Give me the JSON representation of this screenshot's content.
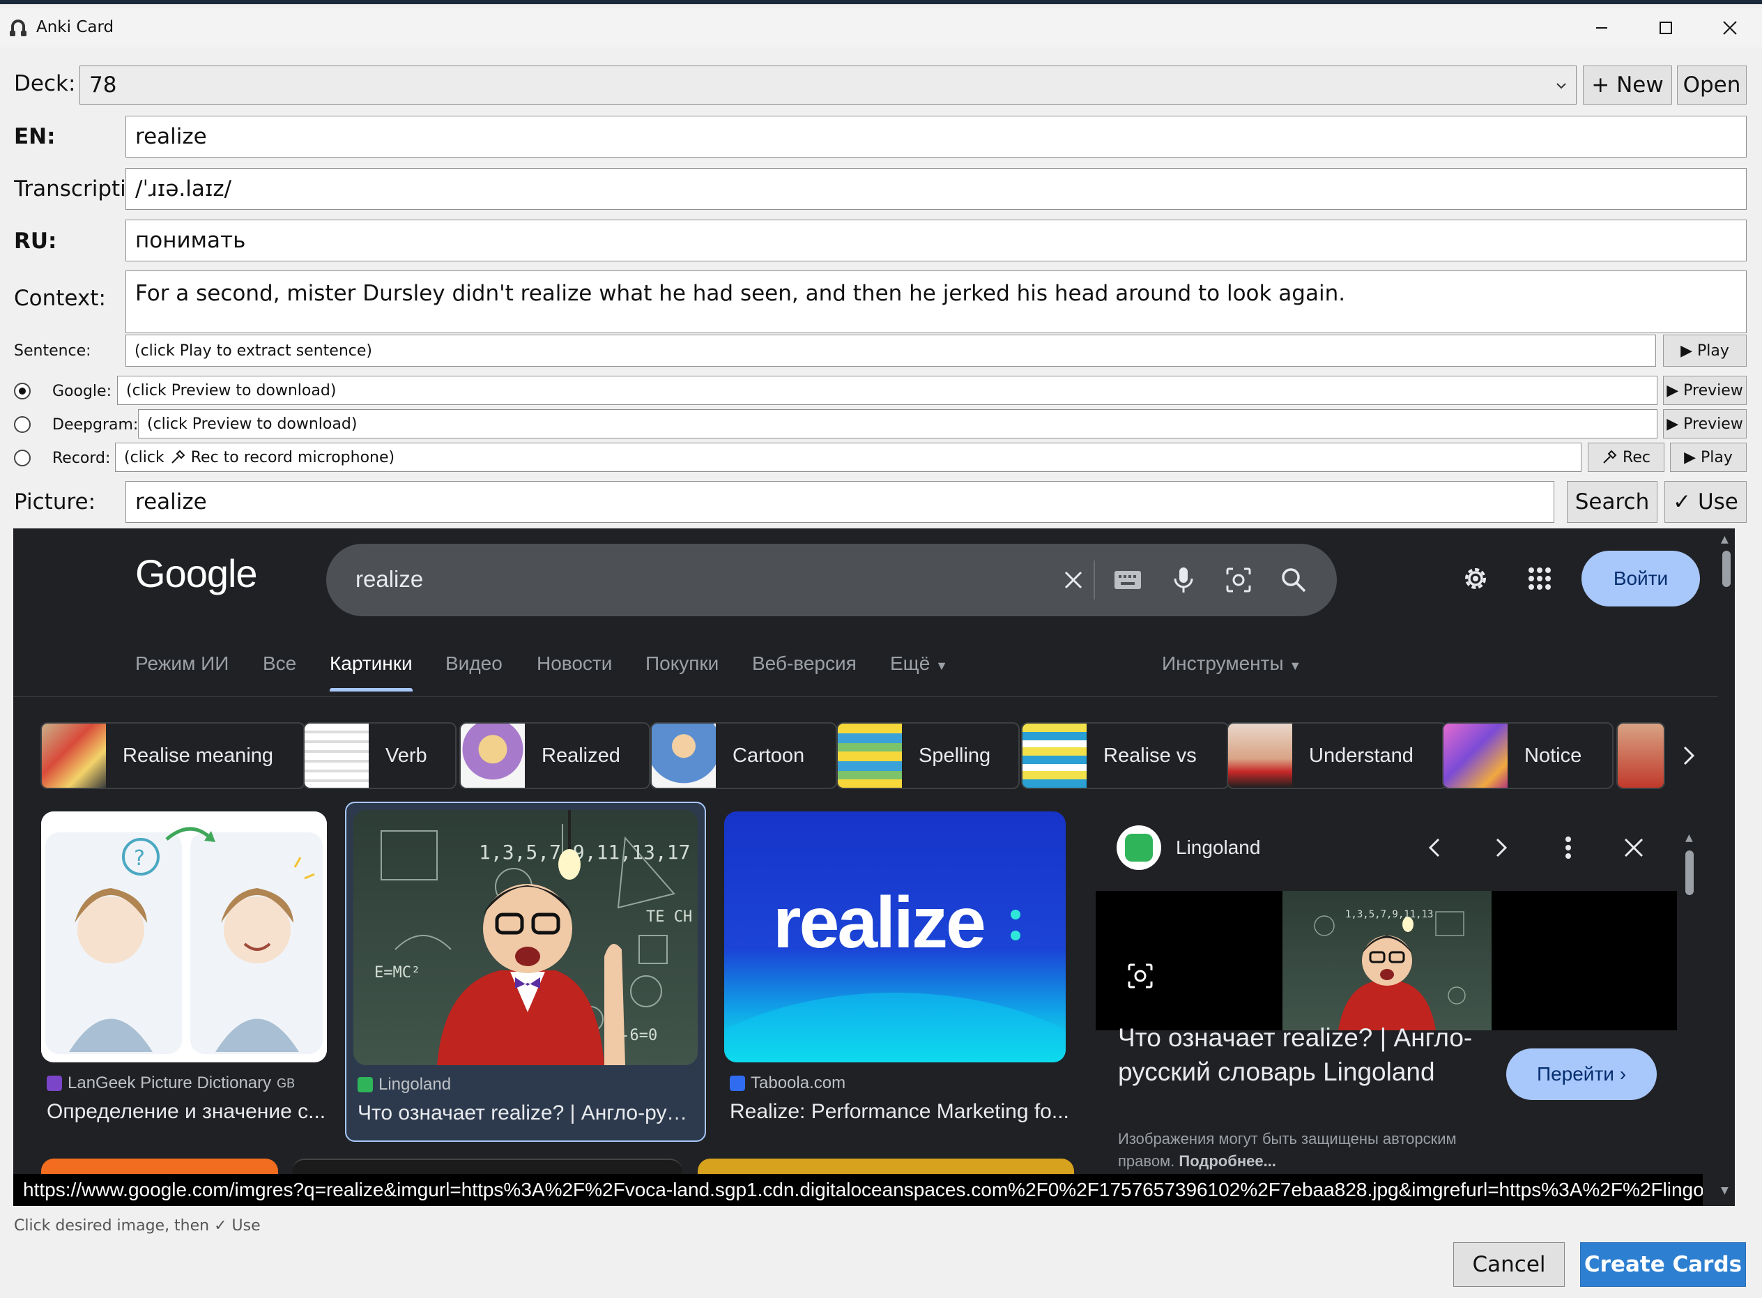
{
  "window": {
    "title": "Anki Card"
  },
  "deck": {
    "label": "Deck:",
    "value": "78",
    "new_btn": "+ New",
    "open_btn": "Open"
  },
  "fields": {
    "en_label": "EN:",
    "en_value": "realize",
    "tr_label": "Transcriptio",
    "tr_value": "/ˈɹɪə.laɪz/",
    "ru_label": "RU:",
    "ru_value": "понимать",
    "ctx_label": "Context:",
    "ctx_value": "For a second, mister Dursley didn't realize what he had seen, and then he jerked his head around to look again."
  },
  "audio": {
    "sentence_label": "Sentence:",
    "sentence_value": "(click Play to extract sentence)",
    "play": "▶ Play",
    "google_label": "Google:",
    "google_value": "(click Preview to download)",
    "preview": "▶ Preview",
    "deepgram_label": "Deepgram:",
    "deepgram_value": "(click Preview to download)",
    "record_label": "Record:",
    "record_value_pre": "(click",
    "record_value_post": "Rec to record microphone)",
    "rec": "Rec",
    "play2": "▶ Play"
  },
  "picture": {
    "label": "Picture:",
    "value": "realize",
    "search": "Search",
    "use": "✓ Use"
  },
  "google": {
    "logo": "Google",
    "query": "realize",
    "login": "Войти",
    "tabs": [
      "Режим ИИ",
      "Все",
      "Картинки",
      "Видео",
      "Новости",
      "Покупки",
      "Веб-версия",
      "Ещё",
      "Инструменты"
    ],
    "chips": [
      "Realise meaning",
      "Verb",
      "Realized",
      "Cartoon",
      "Spelling",
      "Realise vs",
      "Understand",
      "Notice"
    ],
    "results": [
      {
        "source": "LanGeek Picture Dictionary",
        "source_suffix": "GB",
        "caption": "Определение и значение с..."
      },
      {
        "source": "Lingoland",
        "caption": "Что означает realize? | Англо-рус..."
      },
      {
        "source": "Taboola.com",
        "caption": "Realize: Performance Marketing fo..."
      }
    ],
    "brand_text": "realize",
    "panel": {
      "site": "Lingoland",
      "title": "Что означает realize? | Англо-русский словарь Lingoland",
      "go": "Перейти",
      "note": "Изображения могут быть защищены авторским правом.",
      "note_more": "Подробнее..."
    },
    "url": "https://www.google.com/imgres?q=realize&imgurl=https%3A%2F%2Fvoca-land.sgp1.cdn.digitaloceanspaces.com%2F0%2F1757657396102%2F7ebaa828.jpg&imgrefurl=https%3A%2F%2Flingo..."
  },
  "status": "Click desired image, then ✓ Use",
  "footer": {
    "cancel": "Cancel",
    "create": "Create Cards"
  },
  "colors": {
    "accent": "#2d7fd1",
    "google_bg": "#202124",
    "google_blue": "#a8c7fa"
  }
}
